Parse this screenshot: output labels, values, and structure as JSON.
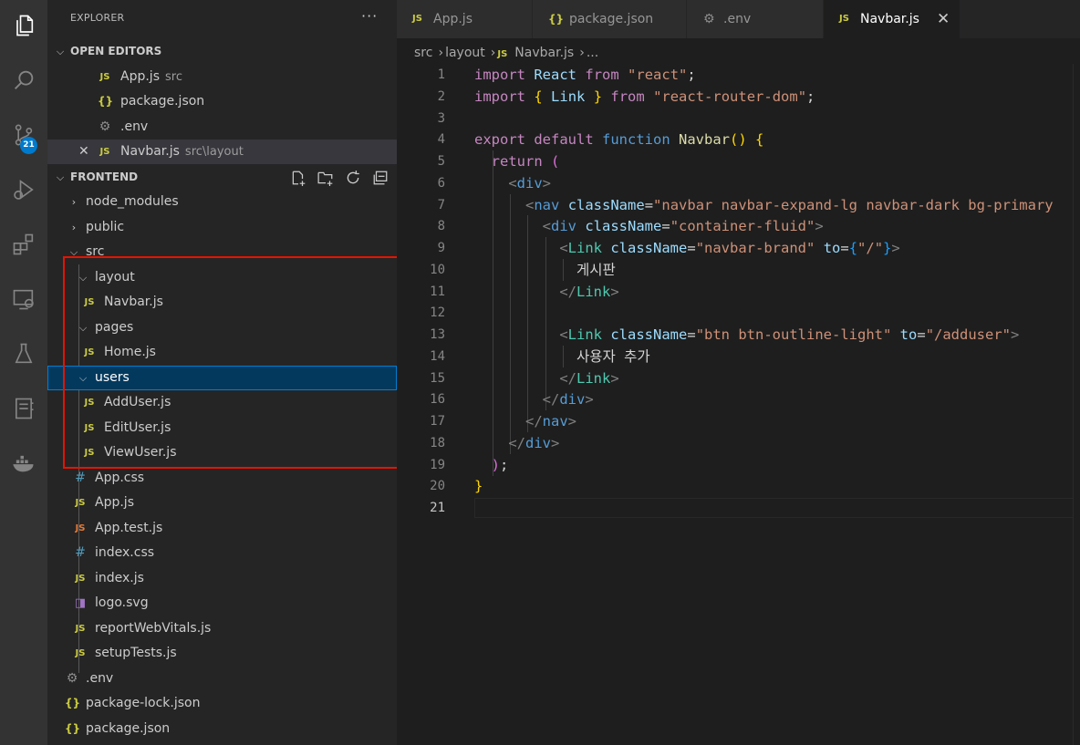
{
  "explorer": {
    "title": "EXPLORER",
    "more": "···",
    "open_editors_label": "OPEN EDITORS",
    "open_editors": [
      {
        "icon": "JS",
        "name": "App.js",
        "path": "src"
      },
      {
        "icon": "{}",
        "name": "package.json",
        "path": ""
      },
      {
        "icon": "⚙",
        "name": ".env",
        "path": ""
      },
      {
        "icon": "JS",
        "name": "Navbar.js",
        "path": "src\\layout"
      }
    ],
    "project_label": "FRONTEND",
    "tree": {
      "node_modules": "node_modules",
      "public": "public",
      "src": "src",
      "layout": "layout",
      "navbar": "Navbar.js",
      "pages": "pages",
      "home": "Home.js",
      "users": "users",
      "adduser": "AddUser.js",
      "edituser": "EditUser.js",
      "viewuser": "ViewUser.js",
      "appcss": "App.css",
      "appjs": "App.js",
      "apptest": "App.test.js",
      "indexcss": "index.css",
      "indexjs": "index.js",
      "logo": "logo.svg",
      "rwv": "reportWebVitals.js",
      "setup": "setupTests.js",
      "env": ".env",
      "lock": "package-lock.json",
      "pkg": "package.json"
    },
    "icons": {
      "js": "JS",
      "json": "{}",
      "css": "#",
      "env": "⚙",
      "svg": "◨"
    }
  },
  "activity": {
    "scm_badge": "21"
  },
  "tabs": [
    {
      "icon": "JS",
      "label": "App.js"
    },
    {
      "icon": "{}",
      "label": "package.json"
    },
    {
      "icon": "⚙",
      "label": ".env"
    },
    {
      "icon": "JS",
      "label": "Navbar.js",
      "close": "✕"
    }
  ],
  "breadcrumb": {
    "parts": [
      "src",
      "layout"
    ],
    "icon": "JS",
    "file": "Navbar.js",
    "tail": "..."
  },
  "editor": {
    "line_numbers": [
      "1",
      "2",
      "3",
      "4",
      "5",
      "6",
      "7",
      "8",
      "9",
      "10",
      "11",
      "12",
      "13",
      "14",
      "15",
      "16",
      "17",
      "18",
      "19",
      "20",
      "21"
    ],
    "code": {
      "l1": {
        "kw": "import",
        "id": "React",
        "from": "from",
        "str": "\"react\"",
        "end": ";"
      },
      "l2": {
        "kw": "import",
        "ob": "{",
        "id": "Link",
        "cb": "}",
        "from": "from",
        "str": "\"react-router-dom\"",
        "end": ";"
      },
      "l4": {
        "kw1": "export",
        "kw2": "default",
        "kw3": "function",
        "fn": "Navbar",
        "par": "()",
        "brace": "{"
      },
      "l5": {
        "kw": "return",
        "par": "("
      },
      "l6": {
        "open": "<",
        "tag": "div",
        "close": ">"
      },
      "l7": {
        "open": "<",
        "tag": "nav",
        "attr": "className",
        "eq": "=",
        "val": "\"navbar navbar-expand-lg navbar-dark bg-primary"
      },
      "l8": {
        "open": "<",
        "tag": "div",
        "attr": "className",
        "eq": "=",
        "val": "\"container-fluid\"",
        "close": ">"
      },
      "l9": {
        "open": "<",
        "tag": "Link",
        "attr": "className",
        "eq": "=",
        "val": "\"navbar-brand\"",
        "attr2": "to",
        "eq2": "=",
        "ob": "{",
        "val2": "\"/\"",
        "cb": "}",
        "close": ">"
      },
      "l10": {
        "text": "게시판"
      },
      "l11": {
        "open": "</",
        "tag": "Link",
        "close": ">"
      },
      "l13": {
        "open": "<",
        "tag": "Link",
        "attr": "className",
        "eq": "=",
        "val": "\"btn btn-outline-light\"",
        "attr2": "to",
        "eq2": "=",
        "val2": "\"/adduser\"",
        "close": ">"
      },
      "l14": {
        "text": "사용자 추가"
      },
      "l15": {
        "open": "</",
        "tag": "Link",
        "close": ">"
      },
      "l16": {
        "open": "</",
        "tag": "div",
        "close": ">"
      },
      "l17": {
        "open": "</",
        "tag": "nav",
        "close": ">"
      },
      "l18": {
        "open": "</",
        "tag": "div",
        "close": ">"
      },
      "l19": {
        "par": ")",
        "end": ";"
      },
      "l20": {
        "brace": "}"
      }
    }
  }
}
